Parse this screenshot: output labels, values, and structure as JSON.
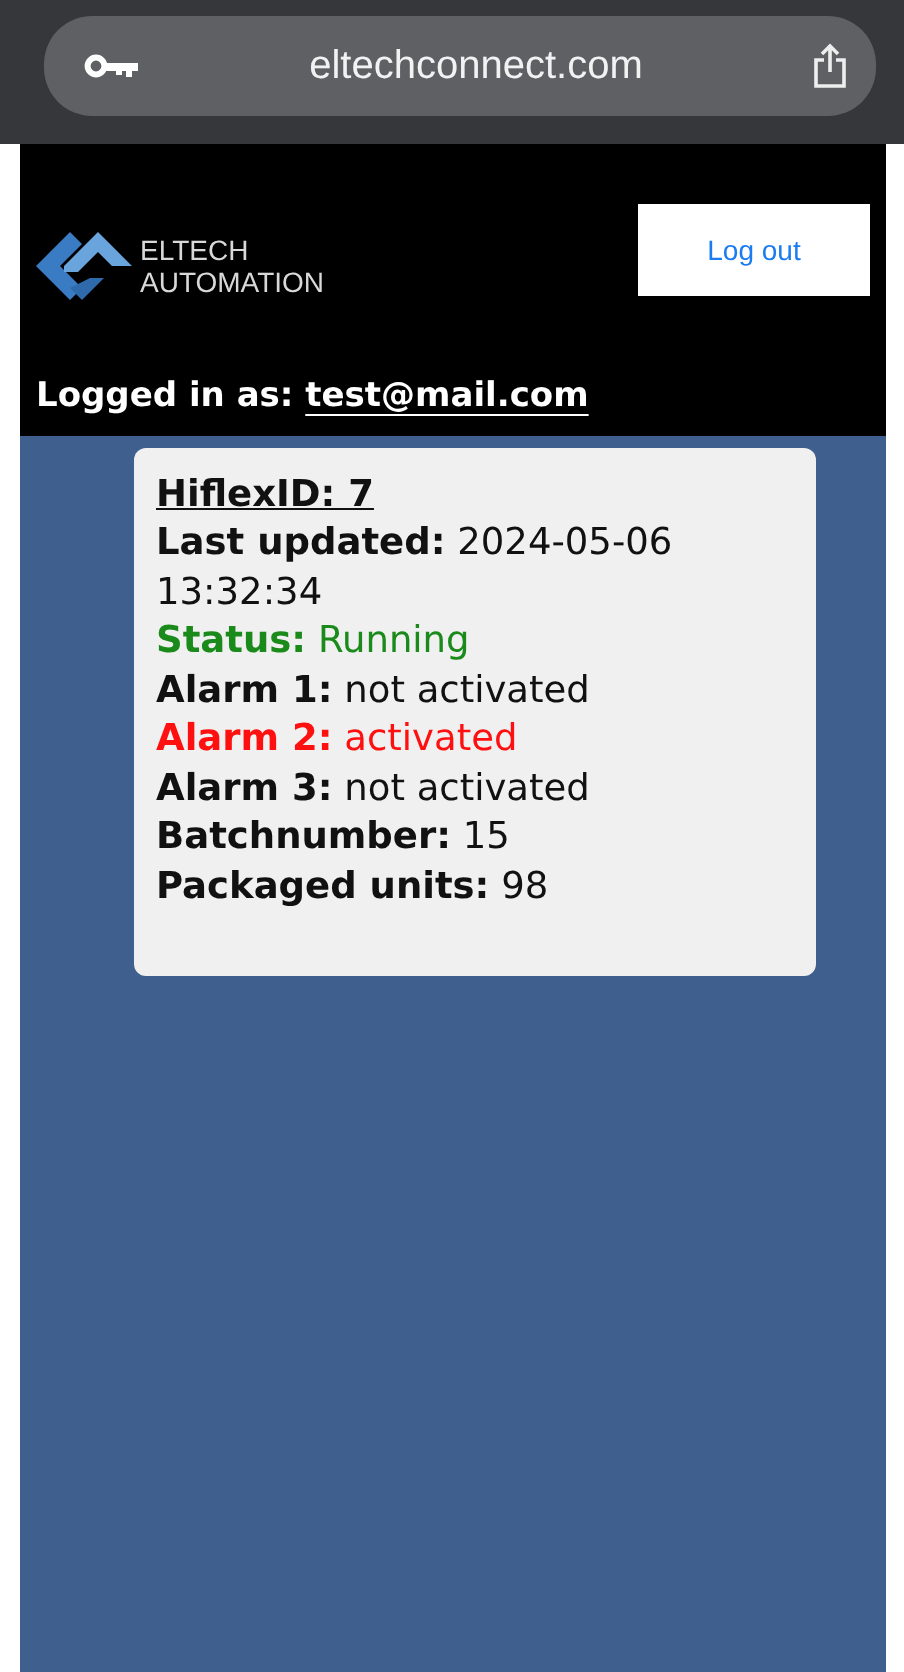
{
  "browser": {
    "url": "eltechconnect.com"
  },
  "header": {
    "logo_lines": [
      "ELTECH",
      "AUTOMATION"
    ],
    "logout_button": "Log out",
    "logged_in_label": "Logged in as:",
    "logged_in_user": "test@mail.com"
  },
  "device_card": {
    "title": "HiflexID: 7",
    "fields": [
      {
        "label": "Last updated:",
        "value": "2024-05-06 13:32:34",
        "kind": "normal"
      },
      {
        "label": "Status:",
        "value": "Running",
        "kind": "ok"
      },
      {
        "label": "Alarm 1:",
        "value": "not activated",
        "kind": "normal"
      },
      {
        "label": "Alarm 2:",
        "value": "activated",
        "kind": "alert"
      },
      {
        "label": "Alarm 3:",
        "value": "not activated",
        "kind": "normal"
      },
      {
        "label": "Batchnumber:",
        "value": "15",
        "kind": "normal"
      },
      {
        "label": "Packaged units:",
        "value": "98",
        "kind": "normal"
      }
    ]
  }
}
